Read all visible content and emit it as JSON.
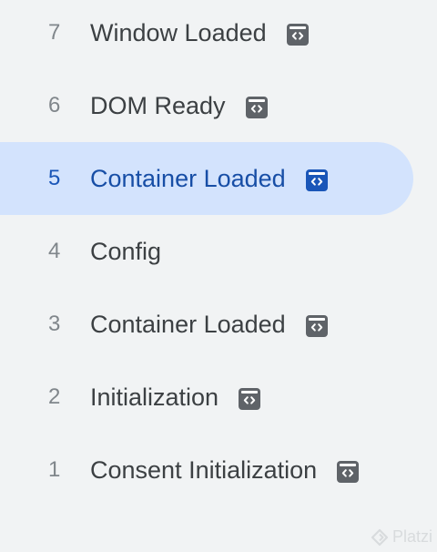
{
  "events": [
    {
      "number": "7",
      "label": "Window Loaded",
      "icon": "code-tag-icon",
      "has_icon": true,
      "selected": false
    },
    {
      "number": "6",
      "label": "DOM Ready",
      "icon": "code-tag-icon",
      "has_icon": true,
      "selected": false
    },
    {
      "number": "5",
      "label": "Container Loaded",
      "icon": "code-tag-icon",
      "has_icon": true,
      "selected": true
    },
    {
      "number": "4",
      "label": "Config",
      "icon": "",
      "has_icon": false,
      "selected": false
    },
    {
      "number": "3",
      "label": "Container Loaded",
      "icon": "code-tag-icon",
      "has_icon": true,
      "selected": false
    },
    {
      "number": "2",
      "label": "Initialization",
      "icon": "code-tag-icon",
      "has_icon": true,
      "selected": false
    },
    {
      "number": "1",
      "label": "Consent Initialization",
      "icon": "code-tag-icon",
      "has_icon": true,
      "selected": false
    }
  ],
  "colors": {
    "background": "#f1f3f4",
    "selected_background": "#d3e3fd",
    "selected_text": "#174ea6",
    "text": "#3c4043",
    "number": "#80868b",
    "icon": "#5f6368",
    "selected_icon": "#1a56b8"
  },
  "watermark": {
    "text": "Platzi",
    "icon": "platzi-logo-icon"
  }
}
